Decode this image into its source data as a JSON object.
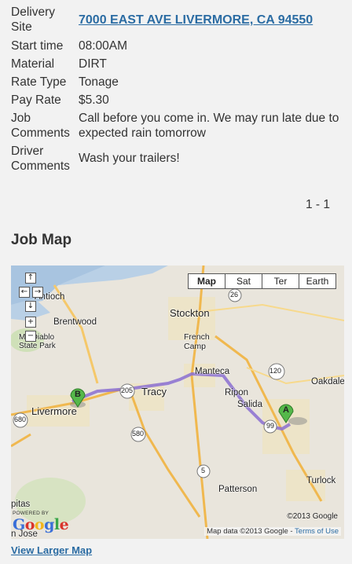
{
  "details": {
    "delivery_site_label": "Delivery Site",
    "delivery_site_value": "7000 EAST AVE LIVERMORE, CA 94550",
    "start_time_label": "Start time",
    "start_time_value": "08:00AM",
    "material_label": "Material",
    "material_value": "DIRT",
    "rate_type_label": "Rate Type",
    "rate_type_value": "Tonage",
    "pay_rate_label": "Pay Rate",
    "pay_rate_value": "$5.30",
    "job_comments_label": "Job Comments",
    "job_comments_value": "Call before you come in. We may run late due to expected rain tomorrow",
    "driver_comments_label": "Driver Comments",
    "driver_comments_value": "Wash your trailers!"
  },
  "pager": "1 - 1",
  "section_title": "Job Map",
  "map": {
    "controls": {
      "up": "↑",
      "left": "←",
      "right": "→",
      "down": "↓",
      "zoom_in": "+",
      "zoom_out": "−"
    },
    "types": [
      "Map",
      "Sat",
      "Ter",
      "Earth"
    ],
    "places": {
      "antioch": "Antioch",
      "brentwood": "Brentwood",
      "mt_diablo": "Mt. Diablo State Park",
      "stockton": "Stockton",
      "french_camp": "French Camp",
      "manteca": "Manteca",
      "oakdale": "Oakdale",
      "tracy": "Tracy",
      "ripon": "Ripon",
      "salida": "Salida",
      "livermore": "Livermore",
      "patterson": "Patterson",
      "turlock": "Turlock",
      "milpitas": "pitas",
      "san_jose": "n Jose"
    },
    "shields": {
      "r26": "26",
      "r205": "205",
      "r120": "120",
      "r580": "580",
      "r680": "680",
      "r99": "99",
      "r5": "5"
    },
    "markers": {
      "a": "A",
      "b": "B"
    },
    "copyright": "©2013 Google",
    "map_data": "Map data ©2013 Google - ",
    "terms": "Terms of Use",
    "powered_by": "POWERED BY",
    "google": "Google",
    "route_color": "#8a6fd1"
  },
  "view_larger_map": "View Larger Map"
}
